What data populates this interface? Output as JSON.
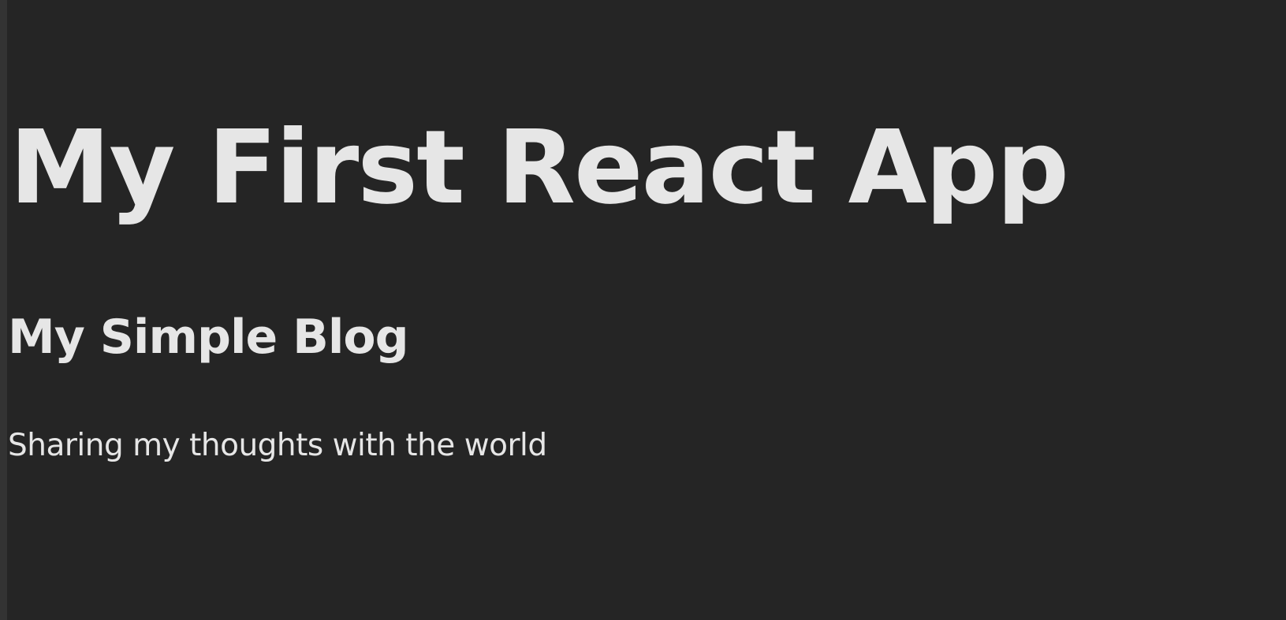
{
  "app": {
    "title": "My First React App"
  },
  "blog": {
    "title": "My Simple Blog",
    "tagline": "Sharing my thoughts with the world"
  },
  "colors": {
    "background": "#252525",
    "text": "#e6e6e6",
    "left_edge": "#333333"
  }
}
